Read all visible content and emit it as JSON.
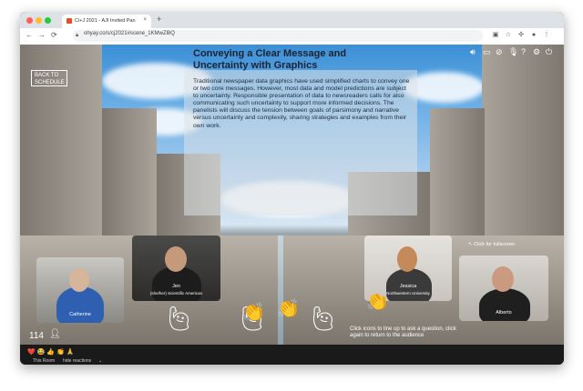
{
  "browser": {
    "tab_title": "Ci+J 2021 - AJI Invited Pan",
    "tab_close": "×",
    "new_tab": "+",
    "url": "ohyay.co/s/cj2021#scene_1KMwZl8Q",
    "back": "←",
    "forward": "→",
    "reload": "⟳"
  },
  "room": {
    "back_button": "BACK TO\nSCHEDULE",
    "panel_title": "Conveying a Clear Message and Uncertainty with Graphics",
    "panel_body": "Traditional newspaper data graphics have used simplified charts to convey one or two core messages. However, most data and model predictions are subject to uncertainty. Responsible presentation of data to newsreaders calls for also communicating such uncertainty to support more informed decisions. The panelists will discuss the tension between goals of parsimony and narrative versus uncertainty and complexity, sharing strategies and examples from their own work.",
    "click_fullscreen": "↖ Click for fullscreen",
    "queue_note": "Click icons to line up to ask a question, click again to return to the audience",
    "audience_count": "114"
  },
  "participants": [
    {
      "name": "Catherine"
    },
    {
      "name": "Jen",
      "subtitle": "(she/her) Scientific American"
    },
    {
      "name": "Jessica",
      "subtitle": "Northwestern University"
    },
    {
      "name": "Alberto"
    }
  ],
  "bottom": {
    "this_room": "This Room",
    "hide_reactions": "hide reactions"
  },
  "reactions": [
    "❤️",
    "😂",
    "👍",
    "👏",
    "🙏"
  ],
  "colors": {
    "accent": "#e94b2a"
  }
}
